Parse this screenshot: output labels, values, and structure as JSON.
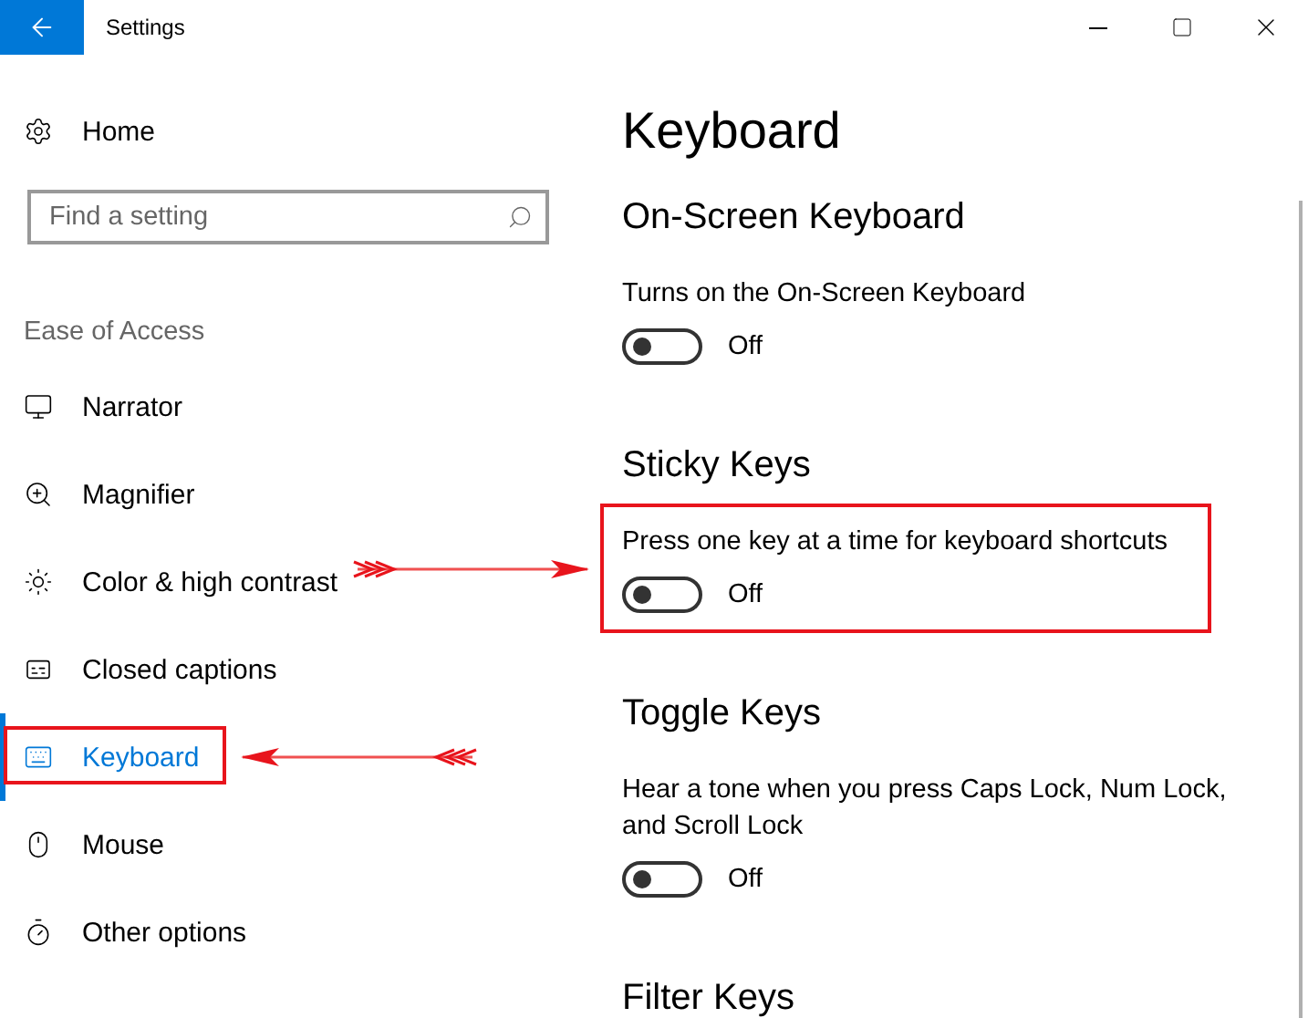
{
  "window": {
    "title": "Settings"
  },
  "sidebar": {
    "home": "Home",
    "search": {
      "placeholder": "Find a setting"
    },
    "group_label": "Ease of Access",
    "items": [
      {
        "label": "Narrator",
        "selected": false,
        "highlighted": false
      },
      {
        "label": "Magnifier",
        "selected": false,
        "highlighted": false
      },
      {
        "label": "Color & high contrast",
        "selected": false,
        "highlighted": false
      },
      {
        "label": "Closed captions",
        "selected": false,
        "highlighted": false
      },
      {
        "label": "Keyboard",
        "selected": true,
        "highlighted": true
      },
      {
        "label": "Mouse",
        "selected": false,
        "highlighted": false
      },
      {
        "label": "Other options",
        "selected": false,
        "highlighted": false
      }
    ]
  },
  "content": {
    "title": "Keyboard",
    "sections": [
      {
        "heading": "On-Screen Keyboard",
        "setting": {
          "description": "Turns on the On-Screen Keyboard",
          "on": false,
          "state_label": "Off",
          "highlighted": false
        }
      },
      {
        "heading": "Sticky Keys",
        "setting": {
          "description": "Press one key at a time for keyboard shortcuts",
          "on": false,
          "state_label": "Off",
          "highlighted": true
        }
      },
      {
        "heading": "Toggle Keys",
        "setting": {
          "description": "Hear a tone when you press Caps Lock, Num Lock, and Scroll Lock",
          "on": false,
          "state_label": "Off",
          "highlighted": false
        }
      },
      {
        "heading": "Filter Keys"
      }
    ]
  }
}
